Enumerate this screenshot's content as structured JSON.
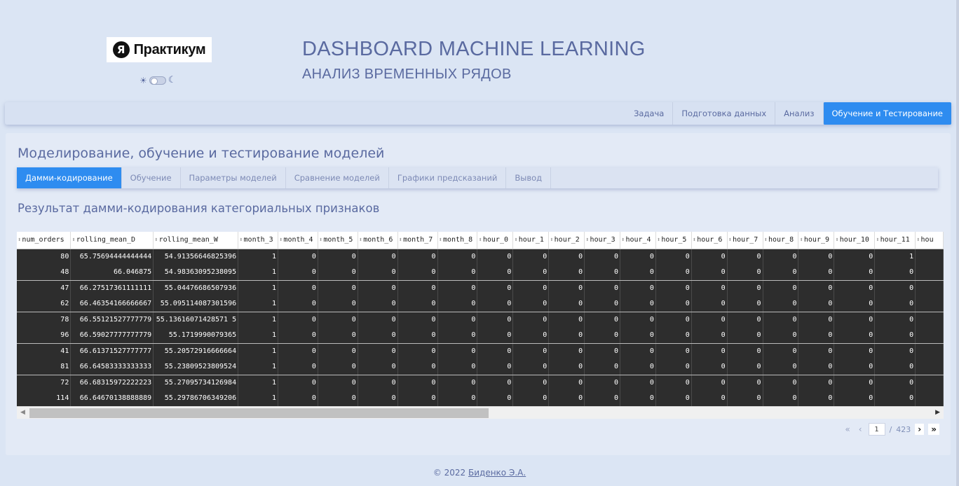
{
  "header": {
    "logo_mark": "Я",
    "logo_text": "Практикум",
    "title": "DASHBOARD MACHINE LEARNING",
    "subtitle": "АНАЛИЗ ВРЕМЕННЫХ РЯДОВ",
    "theme_sun": "☀",
    "theme_moon": "☾"
  },
  "topnav": {
    "items": [
      "Задача",
      "Подготовка данных",
      "Анализ",
      "Обучение и Тестирование"
    ],
    "active_index": 3
  },
  "card": {
    "title": "Моделирование, обучение и тестирование моделей",
    "tabs": [
      "Дамми-кодирование",
      "Обучение",
      "Параметры моделей",
      "Сравнение моделей",
      "Графики предсказаний",
      "Вывод"
    ],
    "active_tab": 0,
    "section_title": "Результат дамми-кодирования категориальных признаков"
  },
  "table": {
    "columns": [
      "num_orders",
      "rolling_mean_D",
      "rolling_mean_W",
      "month_3",
      "month_4",
      "month_5",
      "month_6",
      "month_7",
      "month_8",
      "hour_0",
      "hour_1",
      "hour_2",
      "hour_3",
      "hour_4",
      "hour_5",
      "hour_6",
      "hour_7",
      "hour_8",
      "hour_9",
      "hour_10",
      "hour_11",
      "hou"
    ],
    "rows": [
      [
        "80",
        "65.75694444444444",
        "54.91356646825396",
        "1",
        "0",
        "0",
        "0",
        "0",
        "0",
        "0",
        "0",
        "0",
        "0",
        "0",
        "0",
        "0",
        "0",
        "0",
        "0",
        "0",
        "1",
        ""
      ],
      [
        "48",
        "66.046875",
        "54.98363095238095",
        "1",
        "0",
        "0",
        "0",
        "0",
        "0",
        "0",
        "0",
        "0",
        "0",
        "0",
        "0",
        "0",
        "0",
        "0",
        "0",
        "0",
        "0",
        ""
      ],
      [
        "47",
        "66.27517361111111",
        "55.04476686507936",
        "1",
        "0",
        "0",
        "0",
        "0",
        "0",
        "0",
        "0",
        "0",
        "0",
        "0",
        "0",
        "0",
        "0",
        "0",
        "0",
        "0",
        "0",
        ""
      ],
      [
        "62",
        "66.46354166666667",
        "55.095114087301596",
        "1",
        "0",
        "0",
        "0",
        "0",
        "0",
        "0",
        "0",
        "0",
        "0",
        "0",
        "0",
        "0",
        "0",
        "0",
        "0",
        "0",
        "0",
        ""
      ],
      [
        "78",
        "66.55121527777779",
        "55.13616071428571 5",
        "1",
        "0",
        "0",
        "0",
        "0",
        "0",
        "0",
        "0",
        "0",
        "0",
        "0",
        "0",
        "0",
        "0",
        "0",
        "0",
        "0",
        "0",
        ""
      ],
      [
        "96",
        "66.59027777777779",
        "55.1719990079365",
        "1",
        "0",
        "0",
        "0",
        "0",
        "0",
        "0",
        "0",
        "0",
        "0",
        "0",
        "0",
        "0",
        "0",
        "0",
        "0",
        "0",
        "0",
        ""
      ],
      [
        "41",
        "66.61371527777777",
        "55.20572916666664",
        "1",
        "0",
        "0",
        "0",
        "0",
        "0",
        "0",
        "0",
        "0",
        "0",
        "0",
        "0",
        "0",
        "0",
        "0",
        "0",
        "0",
        "0",
        ""
      ],
      [
        "81",
        "66.64583333333333",
        "55.23809523809524",
        "1",
        "0",
        "0",
        "0",
        "0",
        "0",
        "0",
        "0",
        "0",
        "0",
        "0",
        "0",
        "0",
        "0",
        "0",
        "0",
        "0",
        "0",
        ""
      ],
      [
        "72",
        "66.68315972222223",
        "55.27095734126984",
        "1",
        "0",
        "0",
        "0",
        "0",
        "0",
        "0",
        "0",
        "0",
        "0",
        "0",
        "0",
        "0",
        "0",
        "0",
        "0",
        "0",
        "0",
        ""
      ],
      [
        "114",
        "66.64670138888889",
        "55.29786706349206",
        "1",
        "0",
        "0",
        "0",
        "0",
        "0",
        "0",
        "0",
        "0",
        "0",
        "0",
        "0",
        "0",
        "0",
        "0",
        "0",
        "0",
        "0",
        ""
      ]
    ]
  },
  "pagination": {
    "first": "«",
    "prev": "‹",
    "current": "1",
    "separator": "/",
    "total": "423",
    "next": "›",
    "last": "»"
  },
  "footer": {
    "copyright": "© 2022",
    "author": "Биденко Э.А."
  }
}
